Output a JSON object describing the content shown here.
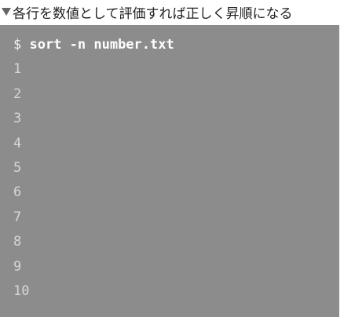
{
  "caption": {
    "text": "各行を数値として評価すれば正しく昇順になる"
  },
  "terminal": {
    "prompt": "$ ",
    "command": "sort -n number.txt",
    "output": [
      "1",
      "2",
      "3",
      "4",
      "5",
      "6",
      "7",
      "8",
      "9",
      "10"
    ],
    "colors": {
      "background": "#8c8c8c",
      "command": "#ffffff",
      "output": "#d6d6d6"
    }
  }
}
